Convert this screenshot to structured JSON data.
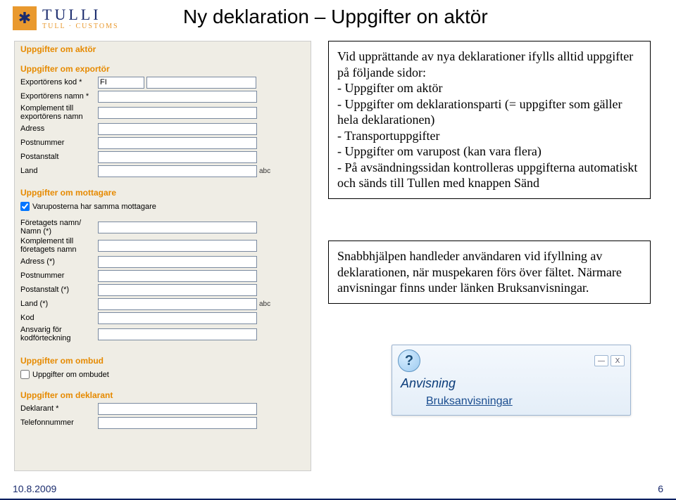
{
  "logo": {
    "main": "TULLI",
    "sub": "TULL · CUSTOMS"
  },
  "page_title": "Ny deklaration – Uppgifter on aktör",
  "form": {
    "section_aktor": "Uppgifter om aktör",
    "section_exportor": "Uppgifter om exportör",
    "kod_label": "Exportörens kod *",
    "kod_value": "FI",
    "namn_label": "Exportörens namn *",
    "komplement_label": "Komplement till exportörens namn",
    "adress_label": "Adress",
    "postnr_label": "Postnummer",
    "postanstalt_label": "Postanstalt",
    "land_label": "Land",
    "abc": "abc",
    "section_mottagare": "Uppgifter om mottagare",
    "samma_mottagare": "Varuposterna har samma mottagare",
    "foretag_label": "Företagets namn/ Namn (*)",
    "foretag_komp_label": "Komplement till företagets namn",
    "adress2_label": "Adress (*)",
    "postnr2_label": "Postnummer",
    "postanstalt2_label": "Postanstalt (*)",
    "land2_label": "Land (*)",
    "kod2_label": "Kod",
    "ansvarig_label": "Ansvarig för kodförteckning",
    "section_ombud": "Uppgifter om ombud",
    "ombud_check": "Uppgifter om ombudet",
    "section_deklarant": "Uppgifter om deklarant",
    "deklarant_label": "Deklarant *",
    "telefon_label": "Telefonnummer"
  },
  "info1": {
    "line1": "Vid upprättande av nya deklarationer ifylls alltid uppgifter på följande sidor:",
    "b1": "- Uppgifter om aktör",
    "b2": "- Uppgifter om deklarationsparti (= uppgifter som gäller hela deklarationen)",
    "b3": "- Transportuppgifter",
    "b4": "- Uppgifter om varupost (kan vara flera)",
    "b5": "- På avsändningssidan kontrolleras uppgifterna automatiskt och sänds till Tullen med knappen Sänd"
  },
  "info2": {
    "text": "Snabbhjälpen handleder användaren vid ifyllning av deklarationen, när muspekaren förs över fältet. Närmare anvisningar finns under länken Bruksanvisningar."
  },
  "help": {
    "title": "Anvisning",
    "link": "Bruksanvisningar"
  },
  "footer": {
    "date": "10.8.2009",
    "page": "6"
  }
}
